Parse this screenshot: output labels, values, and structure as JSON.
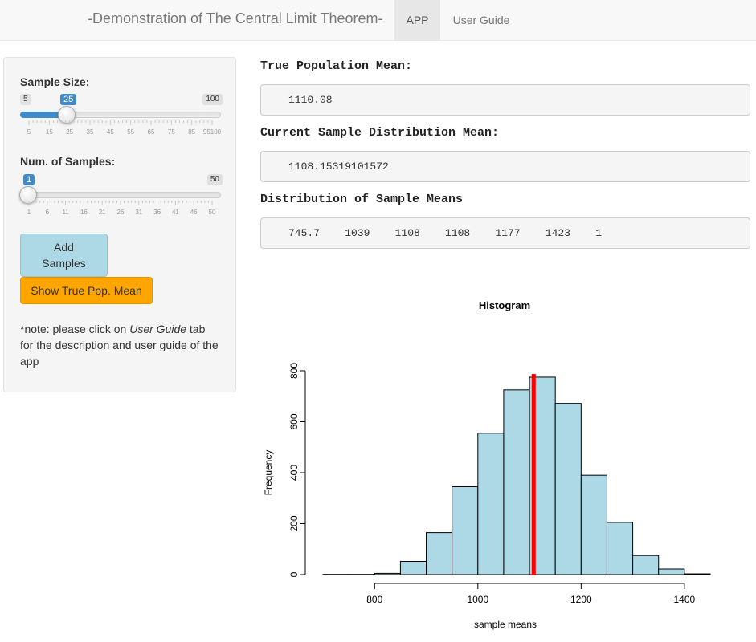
{
  "navbar": {
    "brand": "-Demonstration of The Central Limit Theorem-",
    "tabs": [
      {
        "label": "APP",
        "active": true
      },
      {
        "label": "User Guide",
        "active": false
      }
    ]
  },
  "sidebar": {
    "sample_size": {
      "label": "Sample Size:",
      "min": "5",
      "max": "100",
      "value": "25",
      "ticks": [
        "5",
        "15",
        "25",
        "35",
        "45",
        "55",
        "65",
        "75",
        "85",
        "95100"
      ]
    },
    "num_samples": {
      "label": "Num. of Samples:",
      "min": "1",
      "max": "50",
      "value": "1",
      "ticks": [
        "1",
        "6",
        "11",
        "16",
        "21",
        "26",
        "31",
        "36",
        "41",
        "46",
        "50"
      ]
    },
    "add_button": "Add Samples",
    "show_button": "Show True Pop. Mean",
    "note": {
      "prefix": "*note: please click on ",
      "emphasis": "User Guide",
      "suffix": " tab for the description and user guide of the app"
    },
    "colors": {
      "accent": "#428bca",
      "add_button": "#add8e6",
      "show_button": "#ffa500"
    }
  },
  "main": {
    "true_mean_heading": "True Population Mean:",
    "true_mean_value": "1110.08",
    "current_mean_heading": "Current Sample Distribution Mean:",
    "current_mean_value": "1108.15319101572",
    "dist_heading": "Distribution of Sample Means",
    "dist_summary": "745.7    1039    1108    1108    1177    1423    1"
  },
  "chart_data": {
    "type": "bar",
    "title": "Histogram",
    "xlabel": "sample means",
    "ylabel": "Frequency",
    "bin_edges": [
      700,
      750,
      800,
      850,
      900,
      950,
      1000,
      1050,
      1100,
      1150,
      1200,
      1250,
      1300,
      1350,
      1400,
      1450
    ],
    "values": [
      1,
      1,
      5,
      52,
      165,
      345,
      555,
      725,
      775,
      672,
      390,
      205,
      75,
      22,
      3
    ],
    "xticks": [
      800,
      1000,
      1200,
      1400
    ],
    "yticks": [
      0,
      200,
      400,
      600,
      800
    ],
    "xlim": [
      700,
      1450
    ],
    "ylim": [
      0,
      800
    ],
    "bar_color": "#add8e6",
    "mean_line": {
      "x": 1108.15,
      "color": "#ff0000"
    }
  }
}
